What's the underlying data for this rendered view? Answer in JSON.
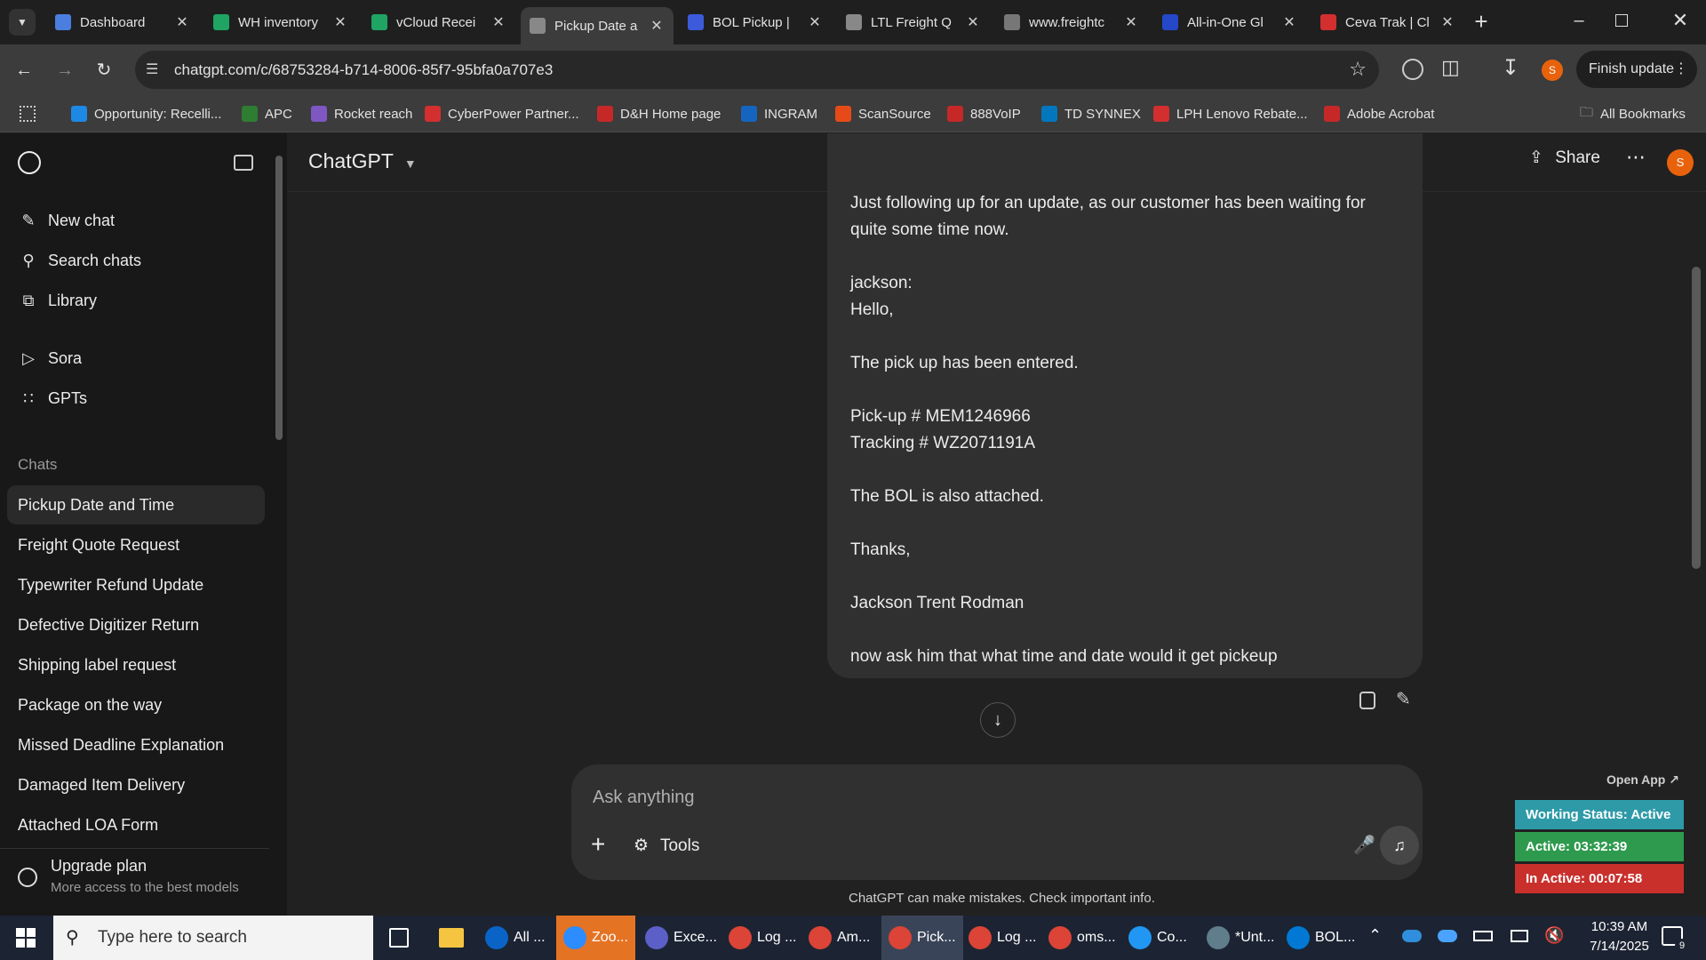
{
  "browser": {
    "tabs": [
      {
        "title": "Dashboard",
        "favicon": "chart-icon",
        "color": "#4a7fe0"
      },
      {
        "title": "WH inventory",
        "favicon": "sheets-icon",
        "color": "#1fa463"
      },
      {
        "title": "vCloud Recei",
        "favicon": "sheets-icon",
        "color": "#1fa463"
      },
      {
        "title": "Pickup Date a",
        "favicon": "chatgpt-icon",
        "color": "#888888"
      },
      {
        "title": "BOL Pickup |",
        "favicon": "freight-icon",
        "color": "#3b5bdb"
      },
      {
        "title": "LTL Freight Q",
        "favicon": "chatgpt-icon",
        "color": "#888888"
      },
      {
        "title": "www.freightc",
        "favicon": "fcc-icon",
        "color": "#777777"
      },
      {
        "title": "All-in-One Gl",
        "favicon": "seventeen-icon",
        "color": "#2448c8"
      },
      {
        "title": "Ceva Trak | Cl",
        "favicon": "ceva-icon",
        "color": "#d32f2f"
      }
    ],
    "url": "chatgpt.com/c/68753284-b714-8006-85f7-95bfa0a707e3",
    "finish_update": "Finish update",
    "profile_initial": "S",
    "bookmarks": [
      {
        "label": "Opportunity: Recelli...",
        "color": "#1e88e5"
      },
      {
        "label": "APC",
        "color": "#2e7d32"
      },
      {
        "label": "Rocket reach",
        "color": "#7e57c2"
      },
      {
        "label": "CyberPower Partner...",
        "color": "#d32f2f"
      },
      {
        "label": "D&H Home page",
        "color": "#c62828"
      },
      {
        "label": "INGRAM",
        "color": "#1565c0"
      },
      {
        "label": "ScanSource",
        "color": "#e64a19"
      },
      {
        "label": "888VoIP",
        "color": "#c62828"
      },
      {
        "label": "TD SYNNEX",
        "color": "#0277bd"
      },
      {
        "label": "LPH Lenovo Rebate...",
        "color": "#d32f2f"
      },
      {
        "label": "Adobe Acrobat",
        "color": "#c62828"
      }
    ],
    "all_bookmarks": "All Bookmarks"
  },
  "sidebar": {
    "nav": [
      {
        "label": "New chat",
        "icon": "new-chat-icon"
      },
      {
        "label": "Search chats",
        "icon": "search-icon"
      },
      {
        "label": "Library",
        "icon": "library-icon"
      },
      {
        "label": "Sora",
        "icon": "sora-icon"
      },
      {
        "label": "GPTs",
        "icon": "gpts-icon"
      }
    ],
    "chats_heading": "Chats",
    "chats": [
      "Pickup Date and Time",
      "Freight Quote Request",
      "Typewriter Refund Update",
      "Defective Digitizer Return",
      "Shipping label request",
      "Package on the way",
      "Missed Deadline Explanation",
      "Damaged Item Delivery",
      "Attached LOA Form"
    ],
    "upgrade": {
      "title": "Upgrade plan",
      "subtitle": "More access to the best models"
    }
  },
  "header": {
    "title": "ChatGPT",
    "share": "Share"
  },
  "message": {
    "lines": [
      "Just following up for an update, as our customer has been waiting for",
      "quite some time now.",
      "",
      "jackson:",
      "Hello,",
      "",
      "The pick up has been entered.",
      "",
      "Pick-up # MEM1246966",
      "Tracking # WZ2071191A",
      "",
      "The BOL is also attached.",
      "",
      "Thanks,",
      "",
      "Jackson Trent Rodman",
      "",
      "now ask him that what time and date would it get pickeup"
    ]
  },
  "composer": {
    "placeholder": "Ask anything",
    "tools": "Tools"
  },
  "disclaimer": "ChatGPT can make mistakes. Check important info.",
  "status_widget": {
    "open_app": "Open App ↗",
    "working": "Working Status: Active",
    "active": "Active: 03:32:39",
    "inactive": "In Active: 00:07:58"
  },
  "taskbar": {
    "search_placeholder": "Type here to search",
    "apps": [
      {
        "label": "All ...",
        "color": "#0a64c8"
      },
      {
        "label": "Zoo...",
        "color": "#2d8cff"
      },
      {
        "label": "Exce...",
        "color": "#5b5fc7"
      },
      {
        "label": "Log ...",
        "color": "#db4437"
      },
      {
        "label": "Am...",
        "color": "#db4437"
      },
      {
        "label": "Pick...",
        "color": "#db4437"
      },
      {
        "label": "Log ...",
        "color": "#db4437"
      },
      {
        "label": "oms...",
        "color": "#db4437"
      },
      {
        "label": "Co...",
        "color": "#2196f3"
      },
      {
        "label": "*Unt...",
        "color": "#607d8b"
      },
      {
        "label": "BOL...",
        "color": "#0078d4"
      }
    ],
    "time": "10:39 AM",
    "date": "7/14/2025",
    "notifications": "9"
  }
}
